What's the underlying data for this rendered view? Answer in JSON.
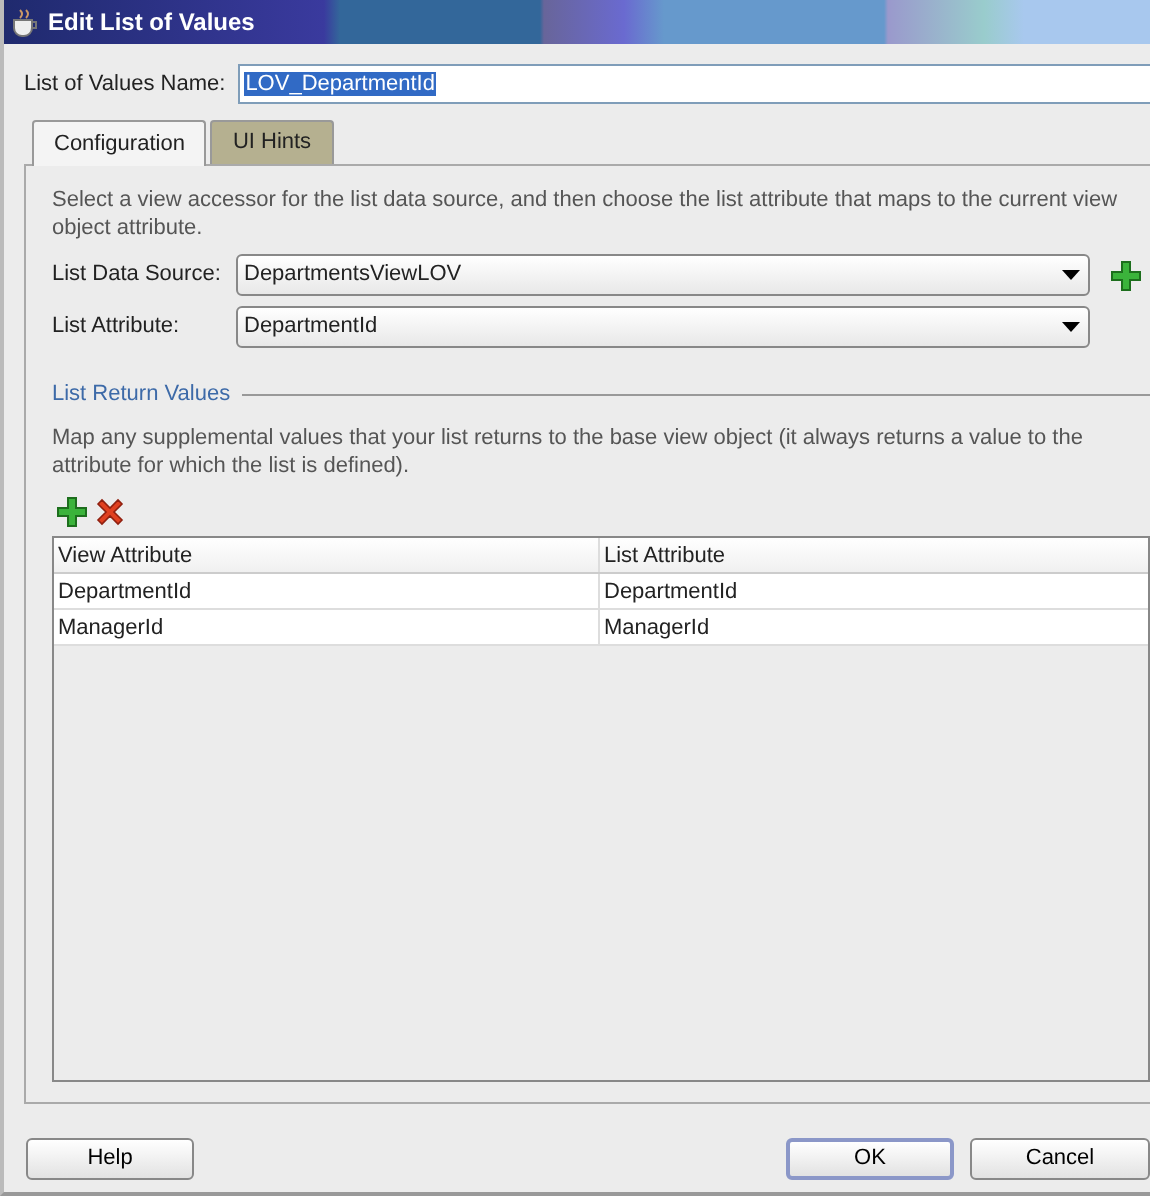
{
  "window": {
    "title": "Edit List of Values"
  },
  "name_field": {
    "label": "List of Values Name:",
    "value": "LOV_DepartmentId",
    "selected": true
  },
  "tabs": [
    {
      "label": "Configuration",
      "selected": true
    },
    {
      "label": "UI Hints",
      "selected": false
    }
  ],
  "description": "Select a view accessor for the list data source, and then choose the list attribute that maps to the current view object attribute.",
  "fields": [
    {
      "label": "List Data Source:",
      "value": "DepartmentsViewLOV",
      "add_button": true
    },
    {
      "label": "List Attribute:",
      "value": "DepartmentId",
      "add_button": false
    }
  ],
  "return_values": {
    "heading": "List Return Values",
    "description": "Map any supplemental values that your list returns to the base view object (it always returns a value to the attribute for which the list is defined).",
    "table": {
      "columns": [
        "View Attribute",
        "List Attribute"
      ],
      "rows": [
        [
          "DepartmentId",
          "DepartmentId"
        ],
        [
          "ManagerId",
          "ManagerId"
        ]
      ]
    }
  },
  "buttons": [
    {
      "label": "Help",
      "kind": "help",
      "default": false
    },
    {
      "label": "OK",
      "kind": "ok",
      "default": true
    },
    {
      "label": "Cancel",
      "kind": "cancel",
      "default": false
    }
  ]
}
